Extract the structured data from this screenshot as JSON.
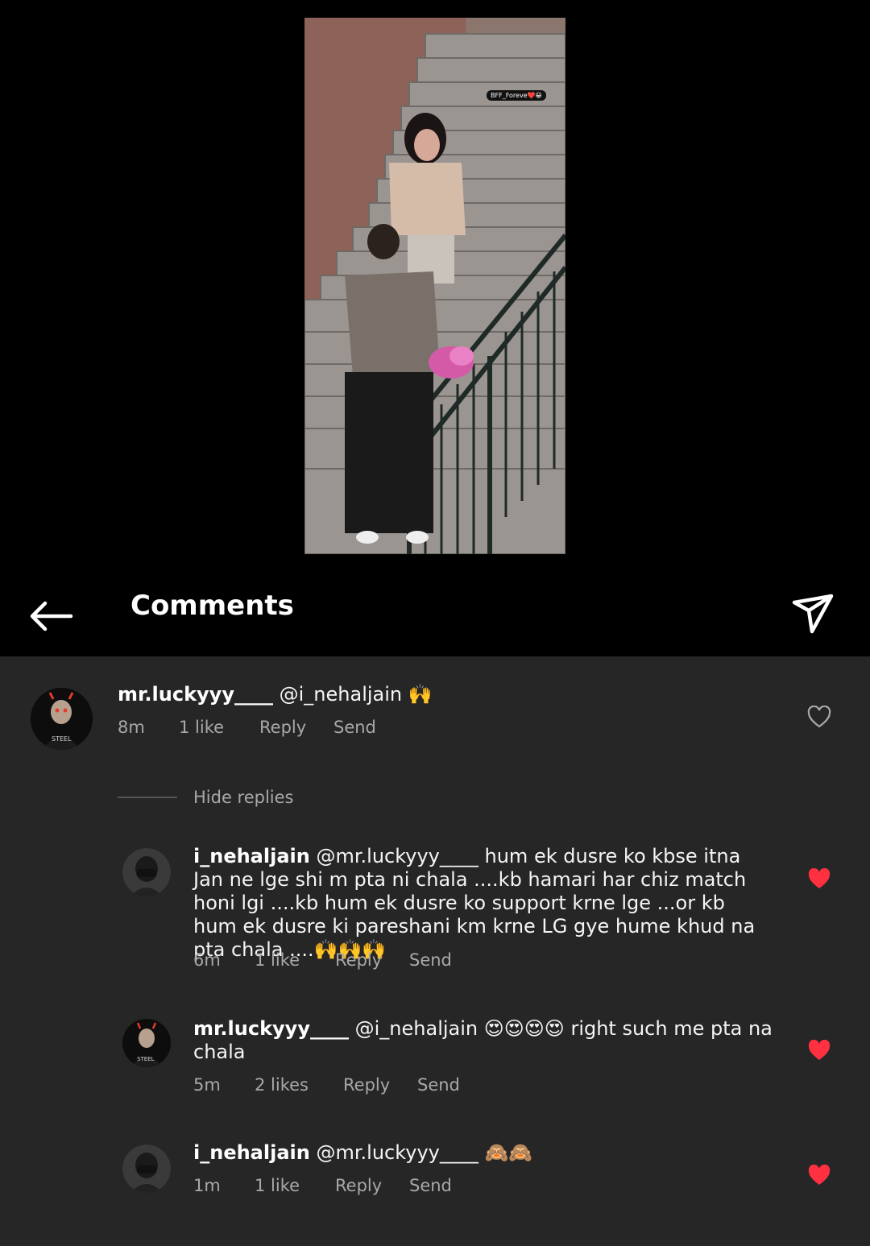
{
  "video": {
    "watermark": "BFF_Foreve❤️😀"
  },
  "header": {
    "title": "Comments",
    "back_icon": "arrow-left-icon",
    "share_icon": "send-icon"
  },
  "colors": {
    "background": "#262626",
    "header": "#000000",
    "liked_heart": "#ff3040",
    "meta_text": "#a8a8a8"
  },
  "thread": {
    "hide_replies_label": "Hide replies",
    "comments": [
      {
        "username": "mr.luckyyy____",
        "text": "@i_nehaljain 🙌",
        "time": "8m",
        "likes": "1 like",
        "reply": "Reply",
        "send": "Send",
        "liked": false
      },
      {
        "username": "i_nehaljain",
        "text": "@mr.luckyyy____ hum ek dusre ko kbse itna Jan ne lge shi m pta ni chala ....kb hamari har chiz match honi lgi ....kb hum ek dusre ko support krne lge ...or kb hum ek dusre ki pareshani km krne LG gye hume khud na pta chala ....🙌🙌🙌",
        "time": "6m",
        "likes": "1 like",
        "reply": "Reply",
        "send": "Send",
        "liked": true
      },
      {
        "username": "mr.luckyyy____",
        "text": "@i_nehaljain 😍😍😍😍 right such me pta na chala",
        "time": "5m",
        "likes": "2 likes",
        "reply": "Reply",
        "send": "Send",
        "liked": true
      },
      {
        "username": "i_nehaljain",
        "text": "@mr.luckyyy____ 🙈🙈",
        "time": "1m",
        "likes": "1 like",
        "reply": "Reply",
        "send": "Send",
        "liked": true
      }
    ]
  }
}
